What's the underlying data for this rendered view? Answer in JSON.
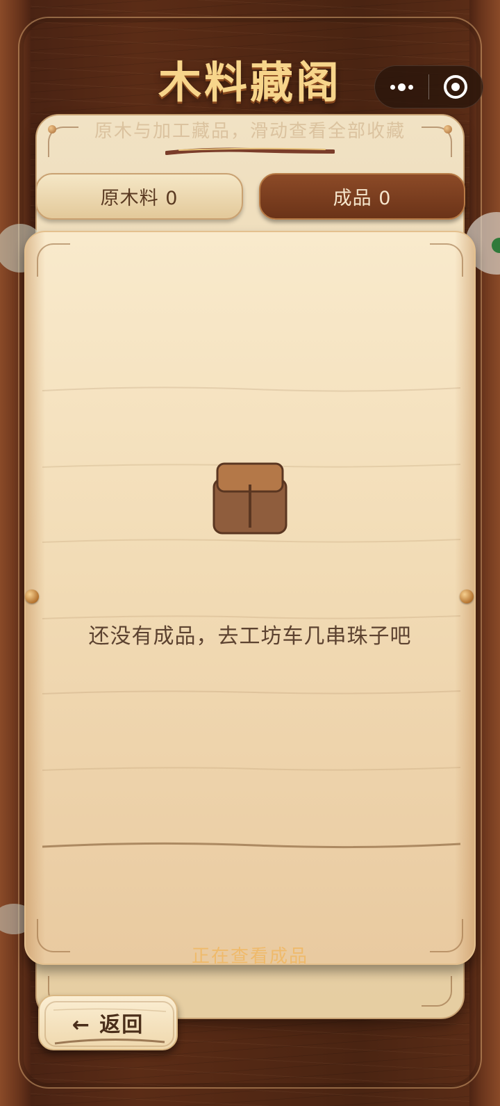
{
  "header": {
    "title": "木料藏阁",
    "subtitle": "原木与加工藏品，滑动查看全部收藏"
  },
  "capsule": {
    "more_icon": "more-dots-icon",
    "close_icon": "target-circle-icon"
  },
  "tabs": [
    {
      "label": "原木料 0",
      "active": false
    },
    {
      "label": "成品 0",
      "active": true
    }
  ],
  "empty_state": {
    "icon": "wooden-box-icon",
    "message": "还没有成品，去工坊车几串珠子吧"
  },
  "status": {
    "viewing": "正在查看成品"
  },
  "back_button": {
    "label": "← 返回"
  },
  "colors": {
    "title": "#f7d58b",
    "active_tab": "#7b3d1f",
    "inactive_tab": "#ecd6ac",
    "card_bg": "#f4e0bc",
    "text_dark": "#5c4230",
    "viewing_text": "#f0b45a"
  }
}
